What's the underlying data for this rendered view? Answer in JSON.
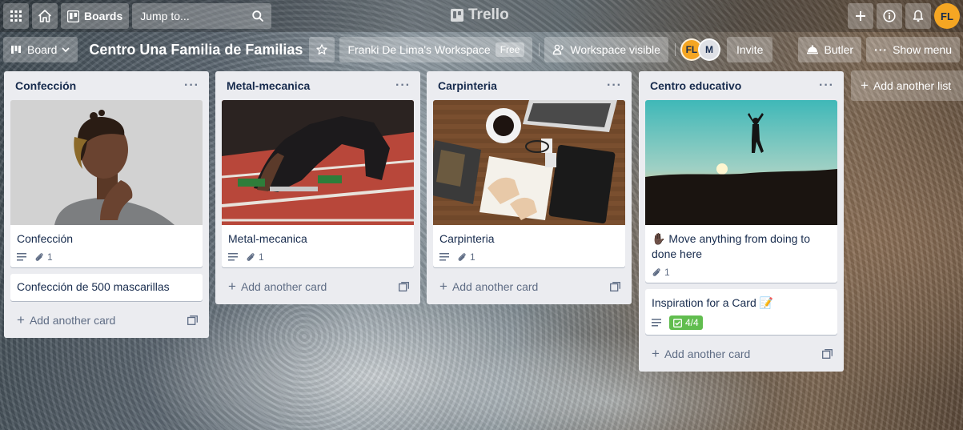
{
  "header": {
    "boards_label": "Boards",
    "jump_placeholder": "Jump to...",
    "app_name": "Trello",
    "user_initials": "FL"
  },
  "board": {
    "view_label": "Board",
    "title": "Centro Una Familia de Familias",
    "workspace_name": "Franki De Lima's Workspace",
    "workspace_plan": "Free",
    "visibility_label": "Workspace visible",
    "members": [
      "FL",
      "M"
    ],
    "invite_label": "Invite",
    "butler_label": "Butler",
    "show_menu_label": "Show menu"
  },
  "lists": [
    {
      "title": "Confección",
      "cards": [
        {
          "title": "Confección",
          "cover": "portrait",
          "has_description": true,
          "attachments": "1"
        },
        {
          "title": "Confección de 500 mascarillas"
        }
      ]
    },
    {
      "title": "Metal-mecanica",
      "cards": [
        {
          "title": "Metal-mecanica",
          "cover": "track",
          "has_description": true,
          "attachments": "1"
        }
      ]
    },
    {
      "title": "Carpinteria",
      "cards": [
        {
          "title": "Carpinteria",
          "cover": "desk",
          "has_description": true,
          "attachments": "1"
        }
      ]
    },
    {
      "title": "Centro educativo",
      "cards": [
        {
          "title": "✋🏿 Move anything from doing to done here",
          "cover": "sunset",
          "attachments": "1"
        },
        {
          "title": "Inspiration for a Card 📝",
          "has_description": true,
          "checklist": "4/4"
        }
      ]
    }
  ],
  "add_card_label": "Add another card",
  "add_list_label": "Add another list",
  "colors": {
    "checklist_complete": "#61bd4f",
    "avatar": "#f5a623",
    "list_bg": "#ebecf0"
  }
}
